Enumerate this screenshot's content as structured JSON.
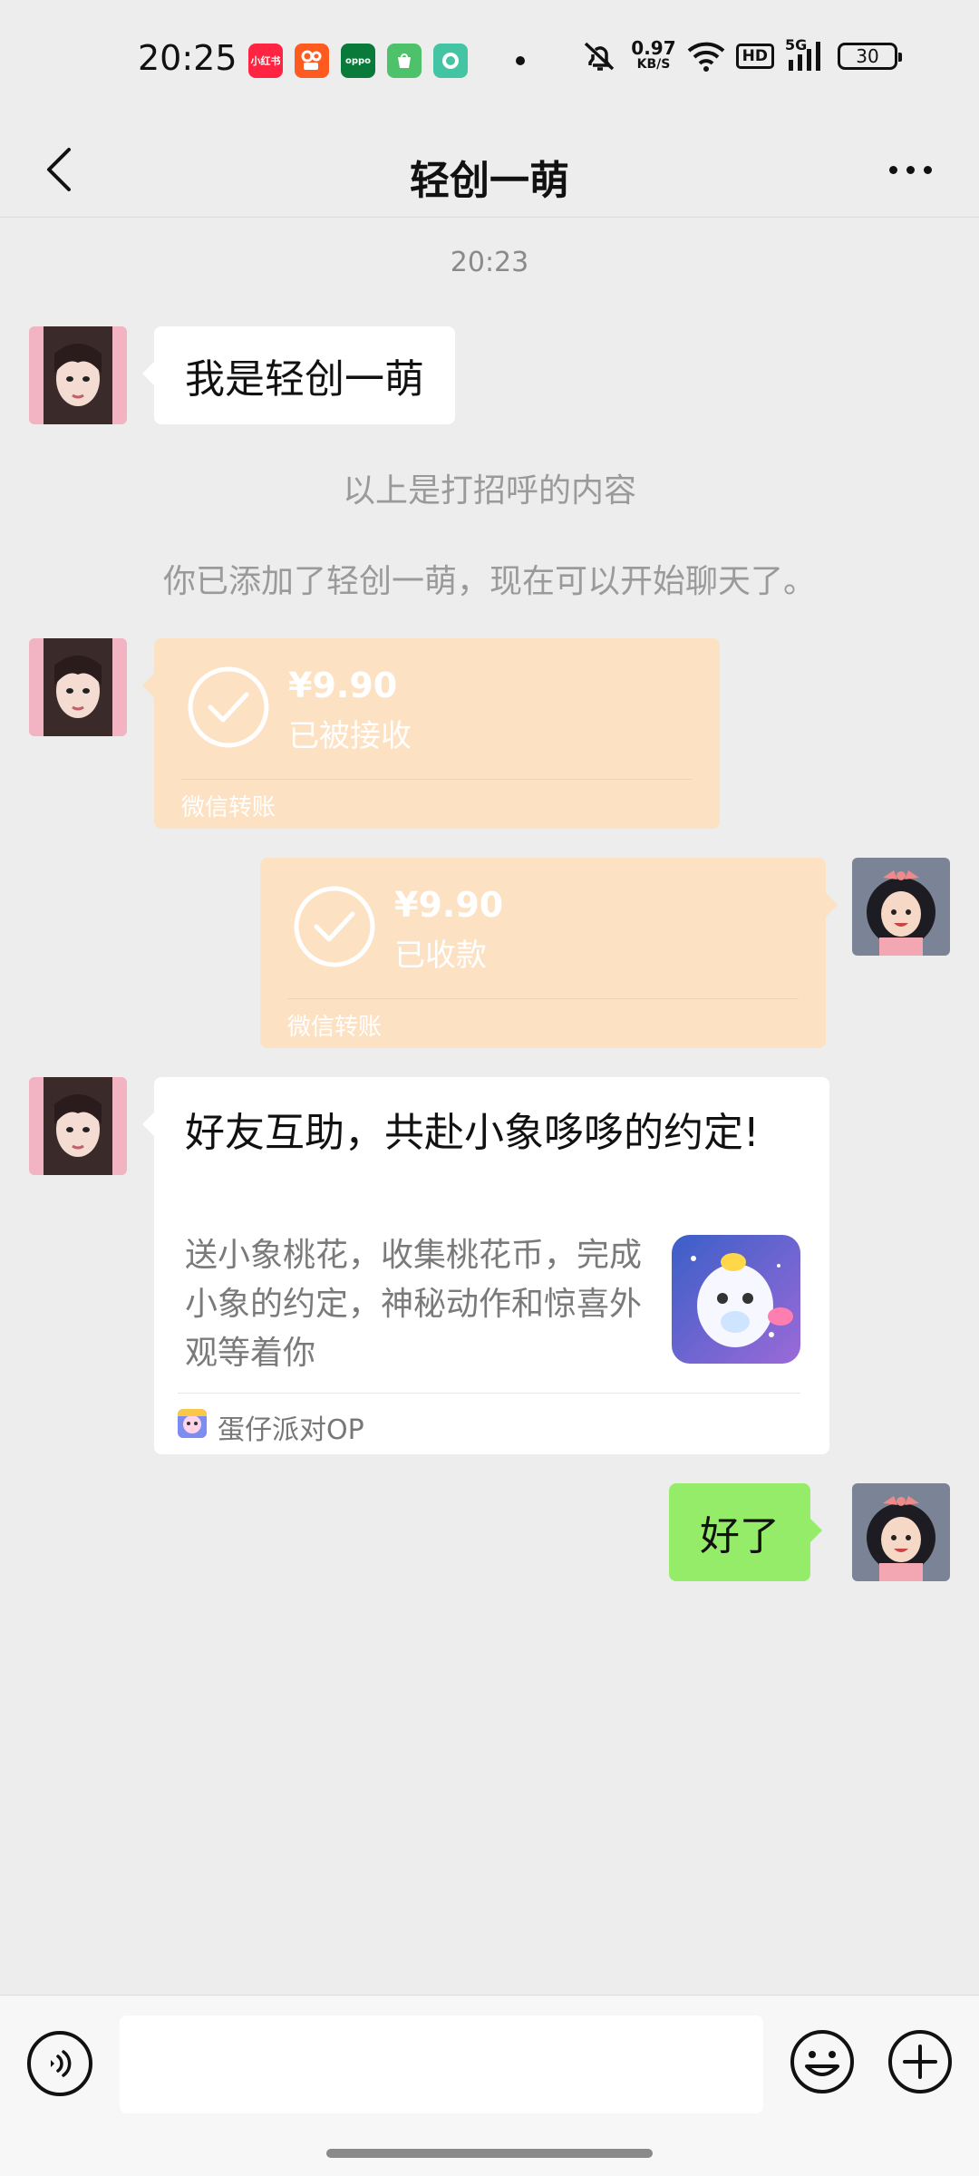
{
  "status_bar": {
    "time": "20:25",
    "apps": [
      {
        "icon": "xiaohongshu-icon",
        "label": "小红书",
        "color": "#ff2442"
      },
      {
        "icon": "kuaishou-icon",
        "label": "",
        "color": "#ff5a1f"
      },
      {
        "icon": "oppo-icon",
        "label": "oppo",
        "color": "#0a7a3b"
      },
      {
        "icon": "store-icon",
        "label": "",
        "color": "#4ec26b"
      },
      {
        "icon": "camera-app-icon",
        "label": "",
        "color": "#43c4a3"
      }
    ],
    "speed_value": "0.97",
    "speed_unit": "KB/S",
    "hd": "HD",
    "network": "5G",
    "battery": "30"
  },
  "nav": {
    "title": "轻创一萌"
  },
  "chat": {
    "timestamp": "20:23",
    "messages": {
      "greeting": "我是轻创一萌",
      "sys_greeting_note": "以上是打招呼的内容",
      "sys_added_note": "你已添加了轻创一萌，现在可以开始聊天了。",
      "transfer_received_left": {
        "amount": "¥9.90",
        "status": "已被接收",
        "source": "微信转账"
      },
      "transfer_received_right": {
        "amount": "¥9.90",
        "status": "已收款",
        "source": "微信转账"
      },
      "share_card": {
        "title": "好友互助，共赴小象哆哆的约定!",
        "description": "送小象桃花，收集桃花币，完成小象的约定，神秘动作和惊喜外观等着你",
        "source": "蛋仔派对OP"
      },
      "reply": "好了"
    }
  },
  "input_bar": {
    "placeholder": ""
  },
  "colors": {
    "chat_bg": "#ededed",
    "transfer_orange": "#fde1c3",
    "sent_green": "#95ec69"
  }
}
